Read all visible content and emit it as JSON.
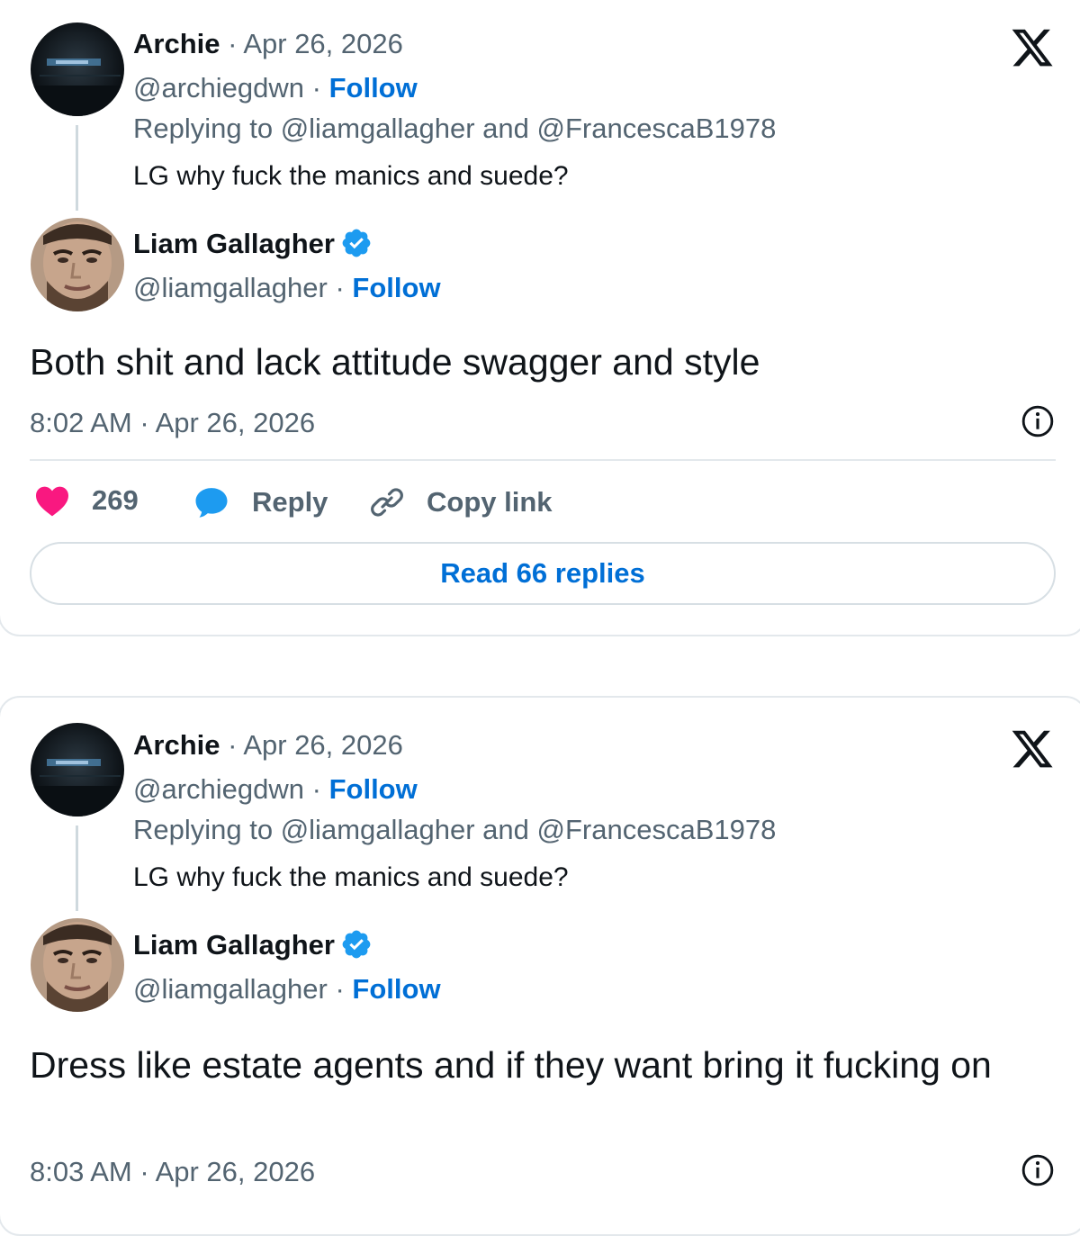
{
  "tweets": [
    {
      "parent": {
        "name": "Archie",
        "date": "· Apr 26, 2026",
        "handle": "@archiegdwn",
        "separator": " · ",
        "follow": "Follow",
        "replying_to": "Replying to @liamgallagher and @FrancescaB1978",
        "text": "LG why fuck the manics and suede?"
      },
      "reply": {
        "name": "Liam Gallagher",
        "handle": "@liamgallagher",
        "separator": " · ",
        "follow": "Follow",
        "text": "Both shit and lack attitude swagger and style",
        "timestamp": "8:02 AM · Apr 26, 2026"
      },
      "actions": {
        "likes": "269",
        "reply": "Reply",
        "copy_link": "Copy link"
      },
      "read_replies": "Read 66 replies"
    },
    {
      "parent": {
        "name": "Archie",
        "date": "· Apr 26, 2026",
        "handle": "@archiegdwn",
        "separator": " · ",
        "follow": "Follow",
        "replying_to": "Replying to @liamgallagher and @FrancescaB1978",
        "text": "LG why fuck the manics and suede?"
      },
      "reply": {
        "name": "Liam Gallagher",
        "handle": "@liamgallagher",
        "separator": " · ",
        "follow": "Follow",
        "text": "Dress like estate agents and if they want bring it fucking on",
        "timestamp": "8:03 AM · Apr 26, 2026"
      }
    }
  ],
  "icons": {
    "brand": "x-logo-icon",
    "verified": "verified-badge-icon",
    "info": "info-icon",
    "like": "heart-icon",
    "reply": "speech-bubble-icon",
    "copy": "link-icon"
  },
  "colors": {
    "text": "#0f1419",
    "muted": "#536471",
    "link": "#006fd6",
    "verified": "#1d9bf0",
    "like": "#f91880",
    "border": "#e3e8ec"
  }
}
